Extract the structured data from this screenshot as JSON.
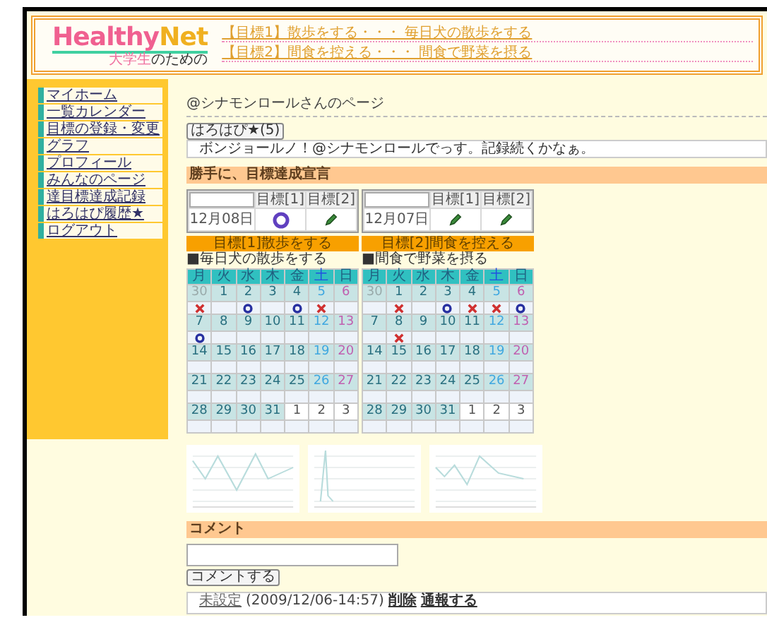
{
  "header": {
    "logo_main": "Healthy",
    "logo_accent": "Net",
    "tagline_accent": "大学生",
    "tagline": "のための",
    "goal_links": [
      "【目標1】散歩をする・・・ 毎日犬の散歩をする",
      "【目標2】間食を控える・・・ 間食で野菜を摂る"
    ]
  },
  "sidebar": {
    "items": [
      "マイホーム",
      "一覧カレンダー",
      "目標の登録・変更",
      "グラフ",
      "プロフィール",
      "みんなのページ",
      "達目標達成記録",
      "はろはぴ履歴★",
      "ログアウト"
    ]
  },
  "page_title": "@シナモンロールさんのページ",
  "status_button": "はろはぴ★(5)",
  "status_message": "ボンジョールノ！@シナモンロールでっす。記録続くかなぁ。",
  "declaration_title": "勝手に、目標達成宣言",
  "cards": [
    {
      "headers": [
        "目標[1]",
        "目標[2]"
      ],
      "date": "12月08日",
      "icons": [
        {
          "kind": "ring"
        },
        {
          "kind": "pencil"
        }
      ],
      "label": "目標[1]散歩をする",
      "subtitle": "■毎日犬の散歩をする",
      "weekdays": [
        "月",
        "火",
        "水",
        "木",
        "金",
        "土",
        "日"
      ],
      "weeks": [
        {
          "days": [
            {
              "text": "30",
              "kind": "prev"
            },
            {
              "text": "1",
              "kind": "weekday"
            },
            {
              "text": "2",
              "kind": "weekday"
            },
            {
              "text": "3",
              "kind": "weekday"
            },
            {
              "text": "4",
              "kind": "weekday"
            },
            {
              "text": "5",
              "kind": "sat"
            },
            {
              "text": "6",
              "kind": "sun"
            }
          ],
          "marks": [
            {
              "kind": "cross"
            },
            {
              "kind": "none"
            },
            {
              "kind": "circle"
            },
            {
              "kind": "none"
            },
            {
              "kind": "circle"
            },
            {
              "kind": "cross"
            },
            {
              "kind": "none"
            }
          ]
        },
        {
          "days": [
            {
              "text": "7",
              "kind": "weekday"
            },
            {
              "text": "8",
              "kind": "weekday"
            },
            {
              "text": "9",
              "kind": "weekday"
            },
            {
              "text": "10",
              "kind": "weekday"
            },
            {
              "text": "11",
              "kind": "weekday"
            },
            {
              "text": "12",
              "kind": "sat"
            },
            {
              "text": "13",
              "kind": "sun"
            }
          ],
          "marks": [
            {
              "kind": "circle"
            },
            {
              "kind": "none"
            },
            {
              "kind": "none"
            },
            {
              "kind": "none"
            },
            {
              "kind": "none"
            },
            {
              "kind": "none"
            },
            {
              "kind": "none"
            }
          ]
        },
        {
          "days": [
            {
              "text": "14",
              "kind": "weekday"
            },
            {
              "text": "15",
              "kind": "weekday"
            },
            {
              "text": "16",
              "kind": "weekday"
            },
            {
              "text": "17",
              "kind": "weekday"
            },
            {
              "text": "18",
              "kind": "weekday"
            },
            {
              "text": "19",
              "kind": "sat"
            },
            {
              "text": "20",
              "kind": "sun"
            }
          ],
          "marks": [
            {
              "kind": "none"
            },
            {
              "kind": "none"
            },
            {
              "kind": "none"
            },
            {
              "kind": "none"
            },
            {
              "kind": "none"
            },
            {
              "kind": "none"
            },
            {
              "kind": "none"
            }
          ]
        },
        {
          "days": [
            {
              "text": "21",
              "kind": "weekday"
            },
            {
              "text": "22",
              "kind": "weekday"
            },
            {
              "text": "23",
              "kind": "weekday"
            },
            {
              "text": "24",
              "kind": "weekday"
            },
            {
              "text": "25",
              "kind": "weekday"
            },
            {
              "text": "26",
              "kind": "sat"
            },
            {
              "text": "27",
              "kind": "sun"
            }
          ],
          "marks": [
            {
              "kind": "none"
            },
            {
              "kind": "none"
            },
            {
              "kind": "none"
            },
            {
              "kind": "none"
            },
            {
              "kind": "none"
            },
            {
              "kind": "none"
            },
            {
              "kind": "none"
            }
          ]
        },
        {
          "days": [
            {
              "text": "28",
              "kind": "weekday"
            },
            {
              "text": "29",
              "kind": "weekday"
            },
            {
              "text": "30",
              "kind": "weekday"
            },
            {
              "text": "31",
              "kind": "weekday"
            },
            {
              "text": "1",
              "kind": "next"
            },
            {
              "text": "2",
              "kind": "next"
            },
            {
              "text": "3",
              "kind": "next"
            }
          ],
          "marks": [
            {
              "kind": "none"
            },
            {
              "kind": "none"
            },
            {
              "kind": "none"
            },
            {
              "kind": "none"
            },
            {
              "kind": "none"
            },
            {
              "kind": "none"
            },
            {
              "kind": "none"
            }
          ]
        }
      ]
    },
    {
      "headers": [
        "目標[1]",
        "目標[2]"
      ],
      "date": "12月07日",
      "icons": [
        {
          "kind": "pencil"
        },
        {
          "kind": "pencil"
        }
      ],
      "label": "目標[2]間食を控える",
      "subtitle": "■間食で野菜を摂る",
      "weekdays": [
        "月",
        "火",
        "水",
        "木",
        "金",
        "土",
        "日"
      ],
      "weeks": [
        {
          "days": [
            {
              "text": "30",
              "kind": "prev"
            },
            {
              "text": "1",
              "kind": "weekday"
            },
            {
              "text": "2",
              "kind": "weekday"
            },
            {
              "text": "3",
              "kind": "weekday"
            },
            {
              "text": "4",
              "kind": "weekday"
            },
            {
              "text": "5",
              "kind": "sat"
            },
            {
              "text": "6",
              "kind": "sun"
            }
          ],
          "marks": [
            {
              "kind": "none"
            },
            {
              "kind": "cross"
            },
            {
              "kind": "none"
            },
            {
              "kind": "circle"
            },
            {
              "kind": "cross"
            },
            {
              "kind": "cross"
            },
            {
              "kind": "circle"
            }
          ]
        },
        {
          "days": [
            {
              "text": "7",
              "kind": "weekday"
            },
            {
              "text": "8",
              "kind": "weekday"
            },
            {
              "text": "9",
              "kind": "weekday"
            },
            {
              "text": "10",
              "kind": "weekday"
            },
            {
              "text": "11",
              "kind": "weekday"
            },
            {
              "text": "12",
              "kind": "sat"
            },
            {
              "text": "13",
              "kind": "sun"
            }
          ],
          "marks": [
            {
              "kind": "none"
            },
            {
              "kind": "cross"
            },
            {
              "kind": "none"
            },
            {
              "kind": "none"
            },
            {
              "kind": "none"
            },
            {
              "kind": "none"
            },
            {
              "kind": "none"
            }
          ]
        },
        {
          "days": [
            {
              "text": "14",
              "kind": "weekday"
            },
            {
              "text": "15",
              "kind": "weekday"
            },
            {
              "text": "16",
              "kind": "weekday"
            },
            {
              "text": "17",
              "kind": "weekday"
            },
            {
              "text": "18",
              "kind": "weekday"
            },
            {
              "text": "19",
              "kind": "sat"
            },
            {
              "text": "20",
              "kind": "sun"
            }
          ],
          "marks": [
            {
              "kind": "none"
            },
            {
              "kind": "none"
            },
            {
              "kind": "none"
            },
            {
              "kind": "none"
            },
            {
              "kind": "none"
            },
            {
              "kind": "none"
            },
            {
              "kind": "none"
            }
          ]
        },
        {
          "days": [
            {
              "text": "21",
              "kind": "weekday"
            },
            {
              "text": "22",
              "kind": "weekday"
            },
            {
              "text": "23",
              "kind": "weekday"
            },
            {
              "text": "24",
              "kind": "weekday"
            },
            {
              "text": "25",
              "kind": "weekday"
            },
            {
              "text": "26",
              "kind": "sat"
            },
            {
              "text": "27",
              "kind": "sun"
            }
          ],
          "marks": [
            {
              "kind": "none"
            },
            {
              "kind": "none"
            },
            {
              "kind": "none"
            },
            {
              "kind": "none"
            },
            {
              "kind": "none"
            },
            {
              "kind": "none"
            },
            {
              "kind": "none"
            }
          ]
        },
        {
          "days": [
            {
              "text": "28",
              "kind": "weekday"
            },
            {
              "text": "29",
              "kind": "weekday"
            },
            {
              "text": "30",
              "kind": "weekday"
            },
            {
              "text": "31",
              "kind": "weekday"
            },
            {
              "text": "1",
              "kind": "next"
            },
            {
              "text": "2",
              "kind": "next"
            },
            {
              "text": "3",
              "kind": "next"
            }
          ],
          "marks": [
            {
              "kind": "none"
            },
            {
              "kind": "none"
            },
            {
              "kind": "none"
            },
            {
              "kind": "none"
            },
            {
              "kind": "none"
            },
            {
              "kind": "none"
            },
            {
              "kind": "none"
            }
          ]
        }
      ]
    }
  ],
  "comment_section": {
    "title": "コメント",
    "button": "コメントする",
    "comments": [
      {
        "author": "未設定",
        "time": "(2009/12/06-14:57)",
        "actions": [
          "削除",
          "通報する"
        ]
      }
    ]
  }
}
